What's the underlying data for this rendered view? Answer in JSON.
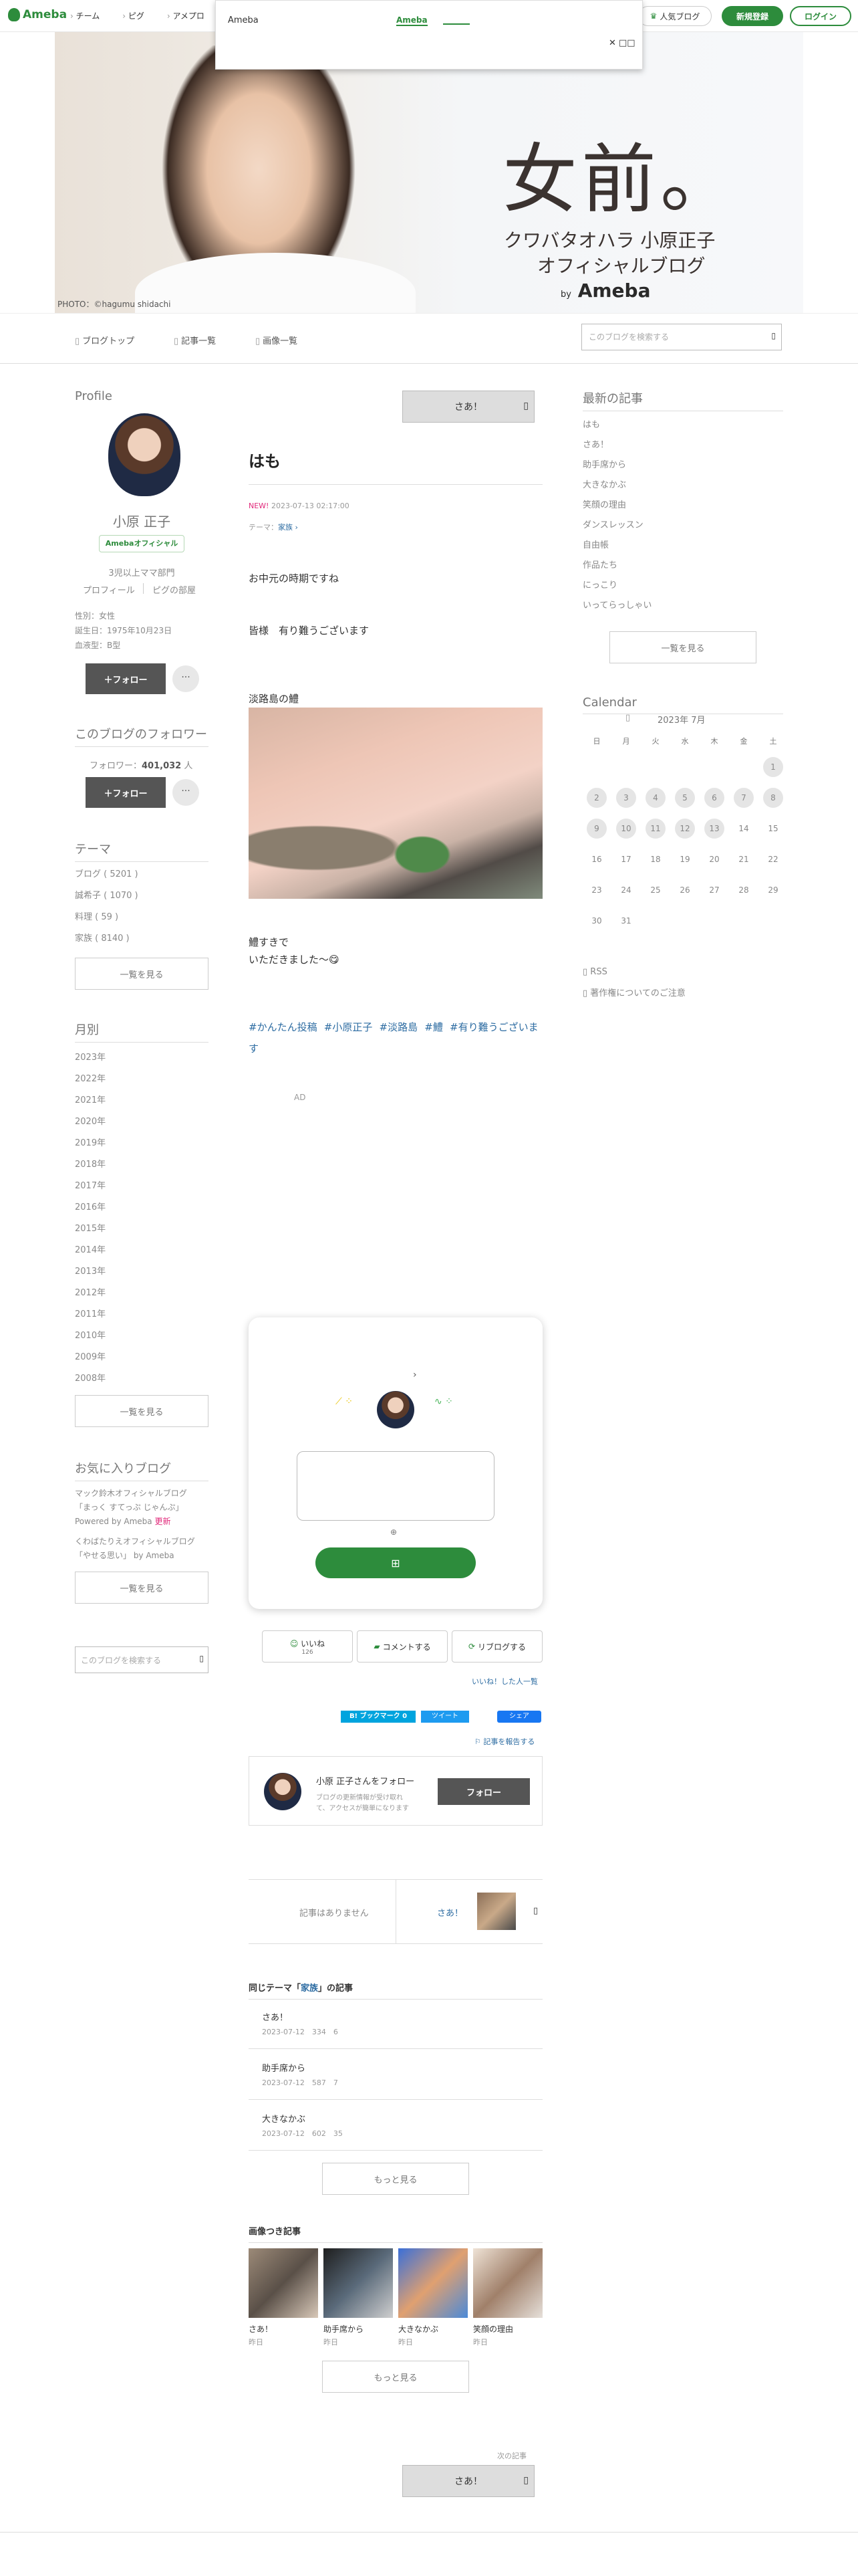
{
  "header": {
    "logo": "Ameba",
    "nav": [
      "チーム",
      "ピグ",
      "アメプロ"
    ],
    "popular": "人気ブログ",
    "signup": "新規登録",
    "login": "ログイン"
  },
  "popup": {
    "title": "Ameba",
    "tab": "Ameba",
    "close": "✕ □□"
  },
  "hero": {
    "title": "女前。",
    "line1": "クワバタオハラ 小原正子",
    "line2": "オフィシャルブログ",
    "by": "by",
    "brand": "Ameba",
    "credit": "PHOTO：©hagumu shidachi"
  },
  "subnav": {
    "items": [
      "ブログトップ",
      "記事一覧",
      "画像一覧"
    ],
    "search_placeholder": "このブログを検索する"
  },
  "profile": {
    "heading": "Profile",
    "name": "小原 正子",
    "badge": "Amebaオフィシャル",
    "rank": "3児以上ママ部門",
    "links": [
      "プロフィール",
      "ピグの部屋"
    ],
    "gender": "性別：女性",
    "birthday": "誕生日：1975年10月23日",
    "blood": "血液型：B型",
    "follow": "＋フォロー",
    "more": "···"
  },
  "followers": {
    "heading": "このブログのフォロワー",
    "count_label": "フォロワー：",
    "count": "401,032",
    "unit": "人",
    "follow": "＋フォロー",
    "more": "···"
  },
  "themes": {
    "heading": "テーマ",
    "items": [
      "ブログ ( 5201 )",
      "誠希子 ( 1070 )",
      "料理 ( 59 )",
      "家族 ( 8140 )"
    ],
    "more": "一覧を見る"
  },
  "monthly": {
    "heading": "月別",
    "items": [
      "2023年",
      "2022年",
      "2021年",
      "2020年",
      "2019年",
      "2018年",
      "2017年",
      "2016年",
      "2015年",
      "2014年",
      "2013年",
      "2012年",
      "2011年",
      "2010年",
      "2009年",
      "2008年"
    ],
    "more": "一覧を見る"
  },
  "favorites": {
    "heading": "お気に入りブログ",
    "item1a": "マック鈴木オフィシャルブログ",
    "item1b": "「まっく すてっぷ じゃんぷ」",
    "item1c": "Powered by Ameba",
    "item1d": "更新",
    "item2a": "くわばたりえオフィシャルブログ",
    "item2b": "「やせる思い」 by Ameba",
    "more": "一覧を見る",
    "search_placeholder": "このブログを検索する"
  },
  "article": {
    "prev_label": "さあ！",
    "title": "はも",
    "new": "NEW!",
    "date": "2023-07-13 02:17:00",
    "theme_label": "テーマ：",
    "theme": "家族",
    "p1": "お中元の時期ですね",
    "p2": "皆様　有り難うございます",
    "p3": "淡路島の鱧",
    "p4": "鱧すきで",
    "p5": "いただきました〜😋",
    "tags": [
      "#かんたん投稿",
      "#小原正子",
      "#淡路島",
      "#鱧",
      "#有り難うございます"
    ],
    "ad": "AD"
  },
  "card": {
    "gift": "⊞"
  },
  "reactions": {
    "like": "いいね",
    "like_count": "126",
    "comment": "コメントする",
    "reblog": "リブログする",
    "liked_people": "いいね！した人一覧",
    "hatena": "B! ブックマーク",
    "hatena_count": "0",
    "tweet": "ツイート",
    "fb": "シェア",
    "report": "記事を報告する"
  },
  "followcard": {
    "title": "小原 正子さんをフォロー",
    "desc1": "ブログの更新情報が受け取れ",
    "desc2": "て、アクセスが簡単になります",
    "btn": "フォロー"
  },
  "pager": {
    "none": "記事はありません",
    "next": "さあ！"
  },
  "related": {
    "heading_pre": "同じテーマ「",
    "heading_theme": "家族",
    "heading_post": "」の記事",
    "items": [
      {
        "title": "さあ！",
        "meta": "2023-07-12　334　6"
      },
      {
        "title": "助手席から",
        "meta": "2023-07-12　587　7"
      },
      {
        "title": "大きなかぶ",
        "meta": "2023-07-12　602　35"
      }
    ],
    "more": "もっと見る"
  },
  "imgarticles": {
    "heading": "画像つき記事",
    "items": [
      {
        "title": "さあ！",
        "sub": "昨日"
      },
      {
        "title": "助手席から",
        "sub": "昨日"
      },
      {
        "title": "大きなかぶ",
        "sub": "昨日"
      },
      {
        "title": "笑顔の理由",
        "sub": "昨日"
      }
    ],
    "more": "もっと見る"
  },
  "bottomnav": {
    "next_label": "次の記事",
    "next": "さあ！"
  },
  "recent": {
    "heading": "最新の記事",
    "items": [
      "はも",
      "さあ！",
      "助手席から",
      "大きなかぶ",
      "笑顔の理由",
      "ダンスレッスン",
      "自由帳",
      "作品たち",
      "にっこり",
      "いってらっしゃい"
    ],
    "more": "一覧を見る"
  },
  "calendar": {
    "heading": "Calendar",
    "month": "2023年 7月",
    "weekdays": [
      "日",
      "月",
      "火",
      "水",
      "木",
      "金",
      "土"
    ],
    "rss": "RSS",
    "copyright": "著作権についてのご注意"
  }
}
